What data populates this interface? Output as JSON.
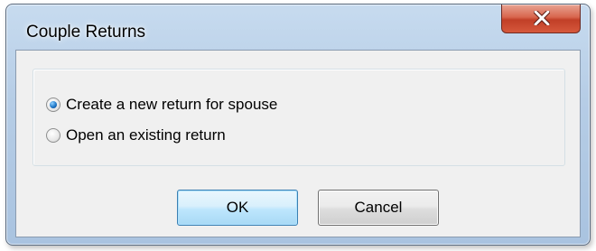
{
  "window": {
    "title": "Couple Returns",
    "close_icon": "close-x-icon"
  },
  "options": {
    "selected": "create_new",
    "items": [
      {
        "id": "create_new",
        "label": "Create a new return for spouse",
        "checked": true
      },
      {
        "id": "open_existing",
        "label": "Open an existing return",
        "checked": false
      }
    ]
  },
  "buttons": {
    "ok_label": "OK",
    "cancel_label": "Cancel"
  },
  "colors": {
    "selected_radio": "#1f78c8",
    "close_button": "#c13f27",
    "default_button_border": "#3c7fb1"
  }
}
